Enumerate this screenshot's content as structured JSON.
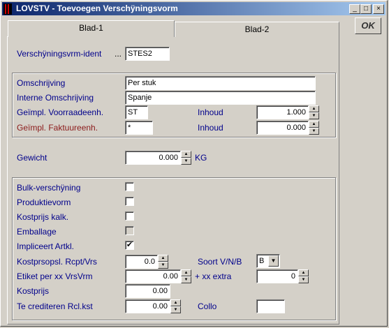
{
  "window": {
    "title": "LOVSTV - Toevoegen Verschÿningsvorm",
    "minimize": "_",
    "maximize": "□",
    "close": "×"
  },
  "ok_label": "OK",
  "tabs": [
    {
      "label": "Blad-1"
    },
    {
      "label": "Blad-2"
    }
  ],
  "ident": {
    "label": "Verschÿningsvrm-ident",
    "dots": "...",
    "value": "STES2"
  },
  "omschrijving": {
    "label": "Omschrijving",
    "value": "Per stuk"
  },
  "interne": {
    "label": "Interne Omschrijving",
    "value": "Spanje"
  },
  "voorraad": {
    "label": "Geïmpl. Voorraadeenh.",
    "value": "ST",
    "inhoud_label": "Inhoud",
    "inhoud_value": "1.000"
  },
  "faktuur": {
    "label": "Geïmpl. Faktuureenh.",
    "value": "*",
    "inhoud_label": "Inhoud",
    "inhoud_value": "0.000"
  },
  "gewicht": {
    "label": "Gewicht",
    "value": "0.000",
    "unit": "KG"
  },
  "checks": [
    {
      "label": "Bulk-verschÿning",
      "checked": false,
      "enabled": true
    },
    {
      "label": "Produktievorm",
      "checked": false,
      "enabled": true
    },
    {
      "label": "Kostprijs kalk.",
      "checked": false,
      "enabled": true
    },
    {
      "label": "Emballage",
      "checked": false,
      "enabled": false
    },
    {
      "label": "Impliceert Artkl.",
      "checked": true,
      "enabled": true
    }
  ],
  "kostprsopsl": {
    "label": "Kostprsopsl. Rcpt/Vrs",
    "value": "0.0"
  },
  "soort": {
    "label": "Soort V/N/B",
    "value": "B"
  },
  "etiket": {
    "label": "Etiket per xx VrsVrm",
    "value": "0.00",
    "extra_label": "+ xx extra",
    "extra_value": "0"
  },
  "kostprijs": {
    "label": "Kostprijs",
    "value": "0.00"
  },
  "crediteren": {
    "label": "Te crediteren Rcl.kst",
    "value": "0.00",
    "collo_label": "Collo",
    "collo_value": ""
  },
  "spin_up": "▲",
  "spin_down": "▼",
  "check_mark": "✔",
  "dropdown_arrow": "▼"
}
